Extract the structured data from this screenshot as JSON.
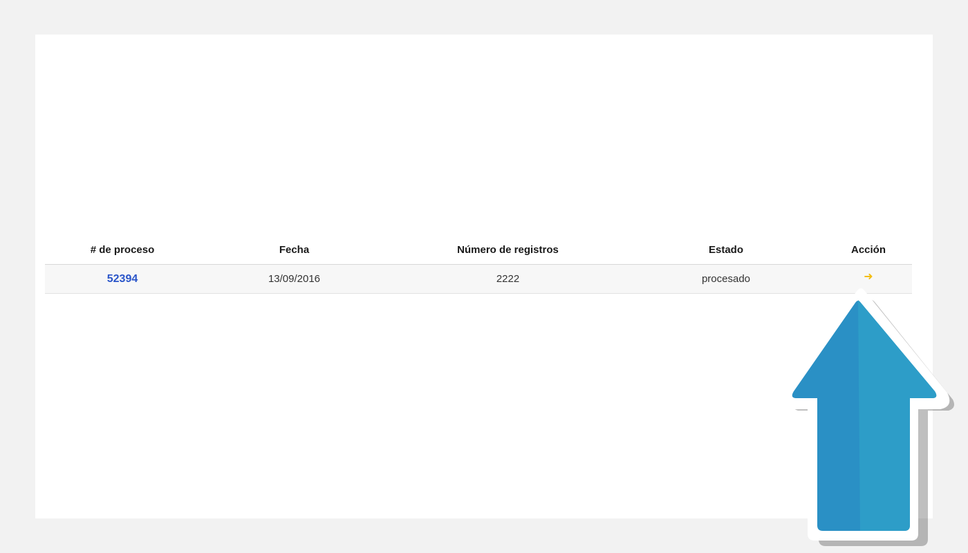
{
  "table": {
    "headers": [
      "# de proceso",
      "Fecha",
      "Número de registros",
      "Estado",
      "Acción"
    ],
    "rows": [
      {
        "proceso": "52394",
        "fecha": "13/09/2016",
        "registros": "2222",
        "estado": "procesado",
        "accion_icon": "arrow-right-icon"
      }
    ]
  },
  "colors": {
    "background": "#f2f2f2",
    "panel": "#ffffff",
    "link": "#2a55c9",
    "action_arrow": "#f3bd12",
    "overlay_arrow": "#2a90c5"
  },
  "overlay": {
    "icon": "up-arrow-icon"
  }
}
